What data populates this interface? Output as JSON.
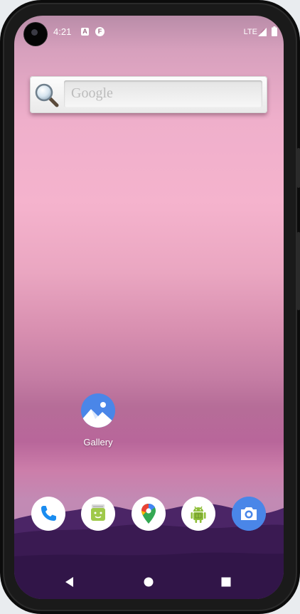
{
  "status_bar": {
    "time": "4:21",
    "notification_a": "A",
    "notification_f": "F",
    "network": "LTE"
  },
  "search_widget": {
    "placeholder": "Google"
  },
  "home_apps": [
    {
      "label": "Gallery",
      "icon": "gallery-icon"
    }
  ],
  "dock": [
    {
      "name": "Phone",
      "icon": "phone-icon"
    },
    {
      "name": "Messaging",
      "icon": "messaging-icon"
    },
    {
      "name": "Maps",
      "icon": "maps-icon"
    },
    {
      "name": "Android app",
      "icon": "android-icon"
    },
    {
      "name": "Camera",
      "icon": "camera-icon"
    }
  ],
  "navigation": [
    "back",
    "home",
    "recents"
  ],
  "colors": {
    "wallpaper_top": "#f5b3cd",
    "wallpaper_horizon": "#b8669a",
    "mountains": "#3d1a55",
    "camera_accent": "#4a86e8"
  }
}
